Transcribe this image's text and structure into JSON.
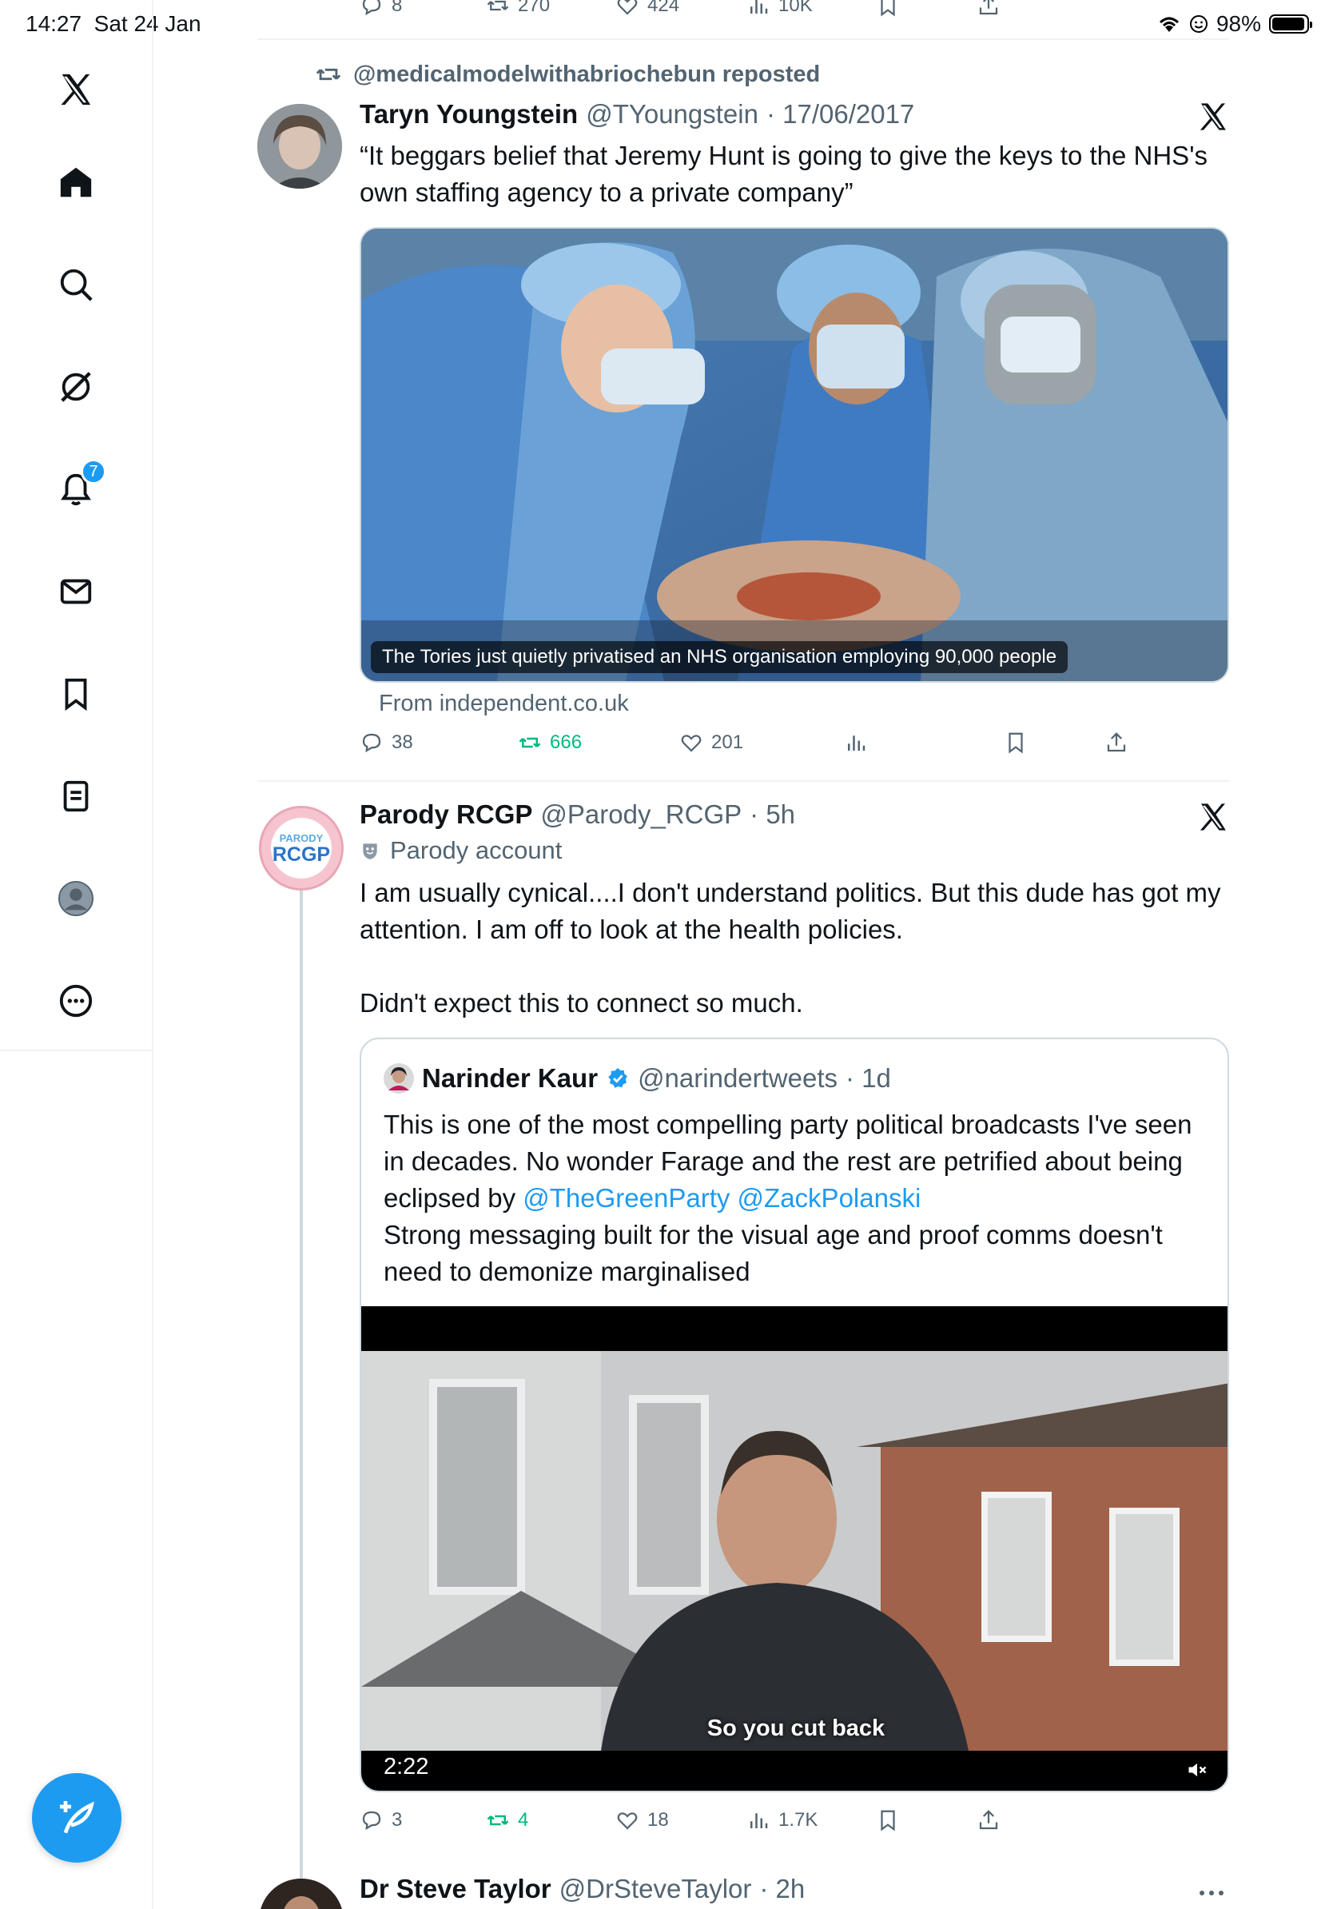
{
  "status_bar": {
    "time": "14:27",
    "date": "Sat 24 Jan",
    "battery": "98%"
  },
  "sidebar": {
    "notifications_badge": "7",
    "items": [
      "x-logo",
      "home",
      "search",
      "grok",
      "notifications",
      "messages",
      "bookmarks",
      "lists",
      "profile",
      "more"
    ]
  },
  "previous_tweet_actions": {
    "replies": "8",
    "reposts": "270",
    "likes": "424",
    "views": "10K"
  },
  "tweet1": {
    "repost_label": "@medicalmodelwithabriochebun reposted",
    "name": "Taryn Youngstein",
    "handle": "@TYoungstein",
    "time": "· 17/06/2017",
    "text": "“It beggars belief that Jeremy Hunt is going to give the keys to the NHS's own staffing agency to a private company”",
    "card_caption": "The Tories just quietly privatised an NHS organisation employing 90,000 people",
    "card_source": "From independent.co.uk",
    "replies": "38",
    "reposts": "666",
    "likes": "201"
  },
  "tweet2": {
    "avatar_top": "PARODY",
    "avatar_main": "RCGP",
    "name": "Parody RCGP",
    "handle": "@Parody_RCGP",
    "time": "· 5h",
    "label": "Parody account",
    "text": "I am usually cynical....I don't understand politics. But this dude has got my attention. I am off to look at the health policies.\n\nDidn't expect this to connect so much.",
    "quote": {
      "name": "Narinder Kaur",
      "handle": "@narindertweets",
      "time": "· 1d",
      "text_a": "This is one of the most compelling party political broadcasts I've seen in decades. No wonder Farage and the rest are petrified about being eclipsed by ",
      "link1": "@TheGreenParty",
      "link2": "@ZackPolanski",
      "text_b": "Strong messaging built for the visual age and proof comms doesn't need to demonize marginalised",
      "video_subtitle": "So you cut back",
      "video_duration": "2:22"
    },
    "replies": "3",
    "reposts": "4",
    "likes": "18",
    "views": "1.7K"
  },
  "tweet3": {
    "name": "Dr Steve Taylor",
    "handle": "@DrSteveTaylor",
    "time": "· 2h"
  },
  "colors": {
    "accent": "#1d9bf0",
    "repost_green": "#00ba7c",
    "muted": "#536471"
  }
}
